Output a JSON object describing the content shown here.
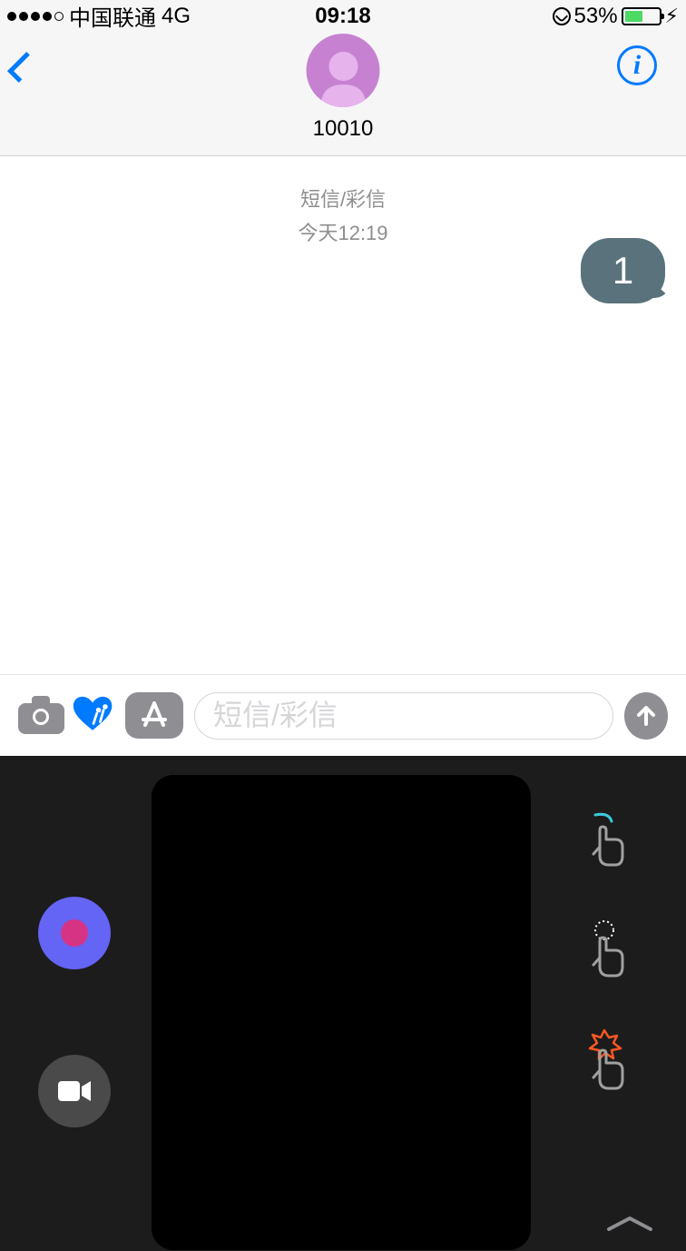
{
  "status": {
    "carrier": "中国联通",
    "network": "4G",
    "time": "09:18",
    "battery_pct": "53%"
  },
  "header": {
    "contact_name": "10010"
  },
  "conversation": {
    "type_label": "短信/彩信",
    "timestamp": "今天12:19",
    "bubble_text": "1"
  },
  "input": {
    "placeholder": "短信/彩信"
  },
  "info_glyph": "i"
}
